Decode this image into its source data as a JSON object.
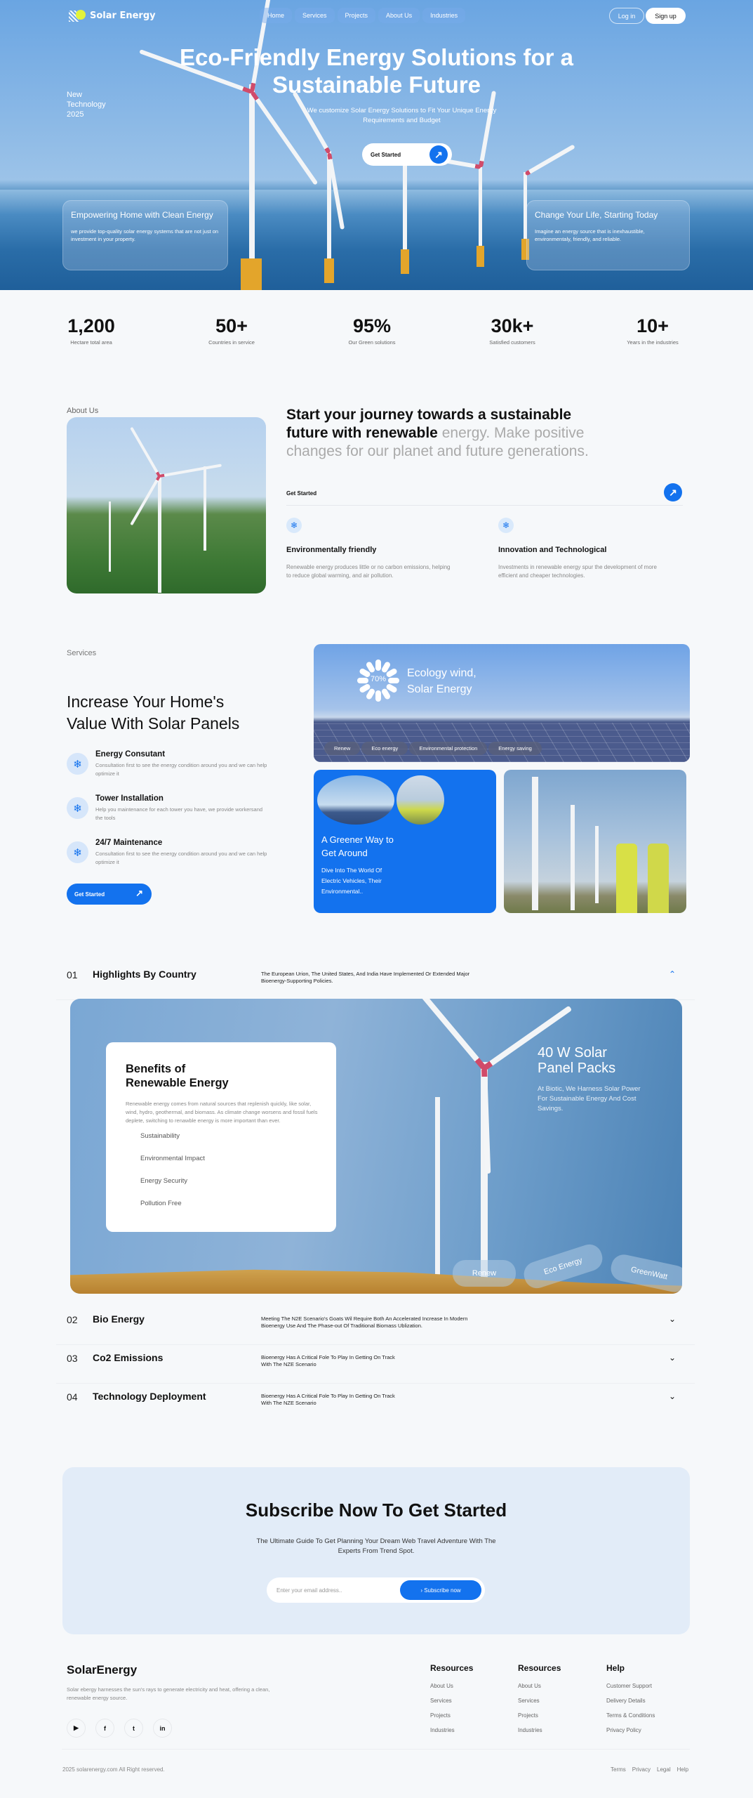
{
  "brand": {
    "name": "Solar Energy",
    "logo_icon": "sun-panel-icon"
  },
  "nav": {
    "links": [
      "Home",
      "Services",
      "Projects",
      "About Us",
      "Industries"
    ],
    "login": "Log in",
    "signup": "Sign up"
  },
  "hero": {
    "title": "Eco-Friendly Energy Solutions for a Sustainable Future",
    "badge": "New Technology 2025",
    "subtitle": "We customize Solar Energy Solutions to Fit Your Unique Energy Requirements and Budget",
    "cta": "Get Started",
    "cta_icon": "arrow-up-right-icon",
    "cards": [
      {
        "title": "Empowering Home with Clean Energy",
        "text": "we provide top-quality solar energy systems that are not just on investment in your property."
      },
      {
        "title": "Change Your Life, Starting Today",
        "text": "Imagine an energy source that is inexhaustible, environmentaly, friendly, and reliable."
      }
    ]
  },
  "stats": [
    {
      "value": "1,200",
      "label": "Hectare total area"
    },
    {
      "value": "50+",
      "label": "Countries in service"
    },
    {
      "value": "95%",
      "label": "Our Green solutions"
    },
    {
      "value": "30k+",
      "label": "Satisfied customers"
    },
    {
      "value": "10+",
      "label": "Years in the industries"
    }
  ],
  "about": {
    "label": "About Us",
    "heading_dark": "Start your journey towards a sustainable future with renewable",
    "heading_light": "energy. Make positive changes for our planet and future generations.",
    "cta": "Get Started",
    "features": [
      {
        "icon": "snowflake-icon",
        "title": "Environmentally friendly",
        "text": "Renewable energy produces little or no carbon emissions, helping to reduce global warming, and air pollution."
      },
      {
        "icon": "snowflake-icon",
        "title": "Innovation and Technological",
        "text": "Investments in renewable energy spur the development of more efficient and cheaper technologies."
      }
    ]
  },
  "services": {
    "label": "Services",
    "heading": "Increase Your Home's Value With Solar Panels",
    "items": [
      {
        "icon": "snowflake-icon",
        "title": "Energy Consutant",
        "text": "Consultation first to see the energy condition around you and we can help optimize it"
      },
      {
        "icon": "snowflake-icon",
        "title": "Tower Installation",
        "text": "Help you maintenance for each tower you have, we provide workersand the tools"
      },
      {
        "icon": "snowflake-icon",
        "title": "24/7 Maintenance",
        "text": "Consultation first to see the energy condition around you and we can help optimize it"
      }
    ],
    "cta": "Get Started",
    "eco_card": {
      "percent": "70%",
      "progress": 0.7,
      "title": "Ecology wind, Solar Energy",
      "tags": [
        "Renew",
        "Eco energy",
        "Environmental protection",
        "Energy saving"
      ]
    },
    "green_card": {
      "title": "A Greener Way to Get Around",
      "text": "Dive Into The World Of Electric Vehicles, Their Environmental.."
    }
  },
  "accordion": [
    {
      "num": "01",
      "title": "Highlights By Country",
      "text": "The European Urion, The United States, And India Have Implemented Or Extended Major Bioenergy-Supporting Policies.",
      "expanded": true
    },
    {
      "num": "02",
      "title": "Bio Energy",
      "text": "Meeting The N2E Scenario's Goats Wil Require Both An Accelerated Increase In Modern Bioenergy Use And The Phase-out Of Traditional Biomass Ublization.",
      "expanded": false
    },
    {
      "num": "03",
      "title": "Co2 Emissions",
      "text": "Bioenergy Has A Critical Fole To Play In Getting On Track With The NZE Scenario",
      "expanded": false
    },
    {
      "num": "04",
      "title": "Technology Deployment",
      "text": "Bioenergy Has A Critical Fole To Play In Getting On Track With The NZE Scenario",
      "expanded": false
    }
  ],
  "feature_card": {
    "benefits_title": "Benefits of Renewable Energy",
    "benefits_text": "Renewable energy comes from natural sources that replenish quickly, like solar, wind, hydro, geothermal, and biomass. As climate change worsens and fossil fuels deplete, switching to renawble energy is more important than ever.",
    "benefits_list": [
      "Sustainability",
      "Environmental Impact",
      "Energy Security",
      "Pollution Free"
    ],
    "promo_title": "40 W Solar Panel Packs",
    "promo_text": "At Biotic, We Harness Solar Power For Sustainable Energy And Cost Savings.",
    "pills": [
      "Renew",
      "Eco Energy",
      "GreenWatt"
    ]
  },
  "subscribe": {
    "title": "Subscribe Now To Get Started",
    "text": "The Ultimate Guide To Get Planning Your Dream Web Travel Adventure With The Experts From Trend Spot.",
    "placeholder": "Enter your email address..",
    "button": "› Subscribe now"
  },
  "footer": {
    "brand": "SolarEnergy",
    "desc": "Solar ebergy harnesses the sun's rays to generate electricity and heat, offering a clean, renewable energy source.",
    "socials": [
      "youtube-icon",
      "facebook-icon",
      "twitter-icon",
      "linkedin-icon"
    ],
    "columns": [
      {
        "title": "Resources",
        "links": [
          "About Us",
          "Services",
          "Projects",
          "Industries"
        ]
      },
      {
        "title": "Resources",
        "links": [
          "About Us",
          "Services",
          "Projects",
          "Industries"
        ]
      },
      {
        "title": "Help",
        "links": [
          "Customer Support",
          "Delivery Details",
          "Terms & Conditions",
          "Privacy Policy"
        ]
      }
    ],
    "copyright": "2025 solarenergy.com All Right reserved.",
    "legal": [
      "Terms",
      "Privacy",
      "Legal",
      "Help"
    ]
  },
  "colors": {
    "accent": "#1372ee",
    "background": "#f6f8fa",
    "subscribe_bg": "#e2ecf8"
  }
}
